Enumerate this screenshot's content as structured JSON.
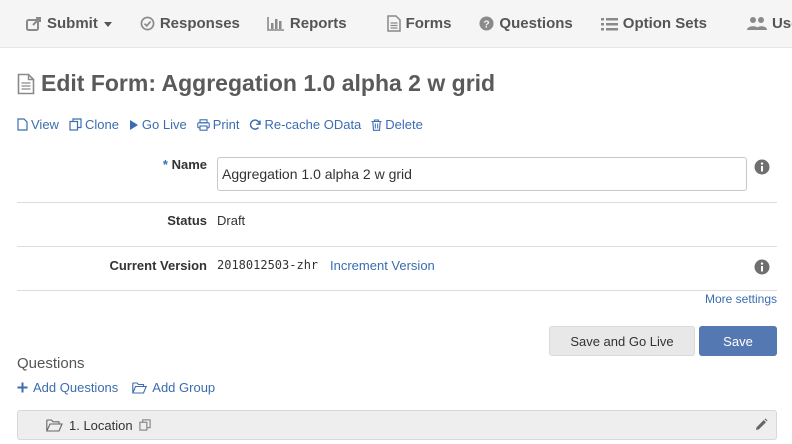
{
  "nav": {
    "submit": "Submit",
    "responses": "Responses",
    "reports": "Reports",
    "forms": "Forms",
    "questions": "Questions",
    "option_sets": "Option Sets",
    "users": "Users"
  },
  "page": {
    "title": "Edit Form: Aggregation 1.0 alpha 2 w grid"
  },
  "actions": {
    "view": "View",
    "clone": "Clone",
    "go_live": "Go Live",
    "print": "Print",
    "recache": "Re-cache OData",
    "delete": "Delete"
  },
  "form": {
    "name_required_mark": "*",
    "name_label": "Name",
    "name_value": "Aggregation 1.0 alpha 2 w grid",
    "status_label": "Status",
    "status_value": "Draft",
    "version_label": "Current Version",
    "version_value": "2018012503-zhr",
    "increment_link": "Increment Version",
    "more_settings": "More settings"
  },
  "buttons": {
    "save_and_go_live": "Save and Go Live",
    "save": "Save"
  },
  "questions": {
    "section_title": "Questions",
    "add_questions": "Add Questions",
    "add_group": "Add Group",
    "groups": [
      {
        "label": "1. Location"
      }
    ]
  },
  "colors": {
    "link": "#3b6db0",
    "primary_button": "#5478b2",
    "nav_background": "#f5f5f6"
  }
}
